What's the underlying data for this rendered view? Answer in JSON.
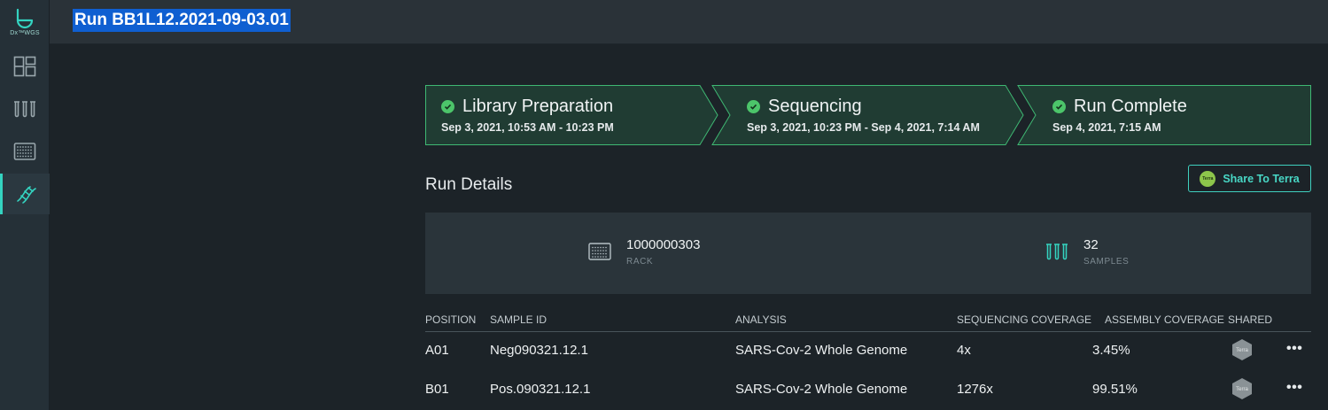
{
  "app": {
    "logo_text": "Dx™WGS",
    "run_title": "Run BB1L12.2021-09-03.01"
  },
  "sidebar": {
    "items": [
      {
        "icon": "dashboard-icon",
        "active": false
      },
      {
        "icon": "test-tubes-icon",
        "active": false
      },
      {
        "icon": "rack-plate-icon",
        "active": false
      },
      {
        "icon": "dna-icon",
        "active": true
      }
    ]
  },
  "steps": [
    {
      "title": "Library Preparation",
      "date": "Sep 3, 2021, 10:53 AM - 10:23 PM",
      "status": "complete"
    },
    {
      "title": "Sequencing",
      "date": "Sep 3, 2021, 10:23 PM - Sep 4, 2021, 7:14 AM",
      "status": "complete"
    },
    {
      "title": "Run Complete",
      "date": "Sep 4, 2021, 7:15 AM",
      "status": "complete"
    }
  ],
  "run_details": {
    "title": "Run Details",
    "share_button": "Share To Terra",
    "terra_badge_text": "Terra",
    "rack": {
      "value": "1000000303",
      "label": "RACK"
    },
    "samples": {
      "value": "32",
      "label": "SAMPLES"
    }
  },
  "table": {
    "headers": {
      "position": "POSITION",
      "sample_id": "SAMPLE ID",
      "analysis": "ANALYSIS",
      "seq_coverage": "SEQUENCING COVERAGE",
      "assembly_coverage": "ASSEMBLY COVERAGE",
      "shared": "SHARED"
    },
    "rows": [
      {
        "position": "A01",
        "sample_id": "Neg090321.12.1",
        "analysis": "SARS-Cov-2 Whole Genome",
        "seq_coverage": "4x",
        "assembly_coverage": "3.45%",
        "shared_badge": "Terra",
        "more": "•••"
      },
      {
        "position": "B01",
        "sample_id": "Pos.090321.12.1",
        "analysis": "SARS-Cov-2 Whole Genome",
        "seq_coverage": "1276x",
        "assembly_coverage": "99.51%",
        "shared_badge": "Terra",
        "more": "•••"
      }
    ]
  },
  "colors": {
    "accent": "#34d3c0",
    "step_complete": "#4cc56a",
    "step_fill": "#203c33",
    "title_highlight": "#0f5fd1"
  }
}
